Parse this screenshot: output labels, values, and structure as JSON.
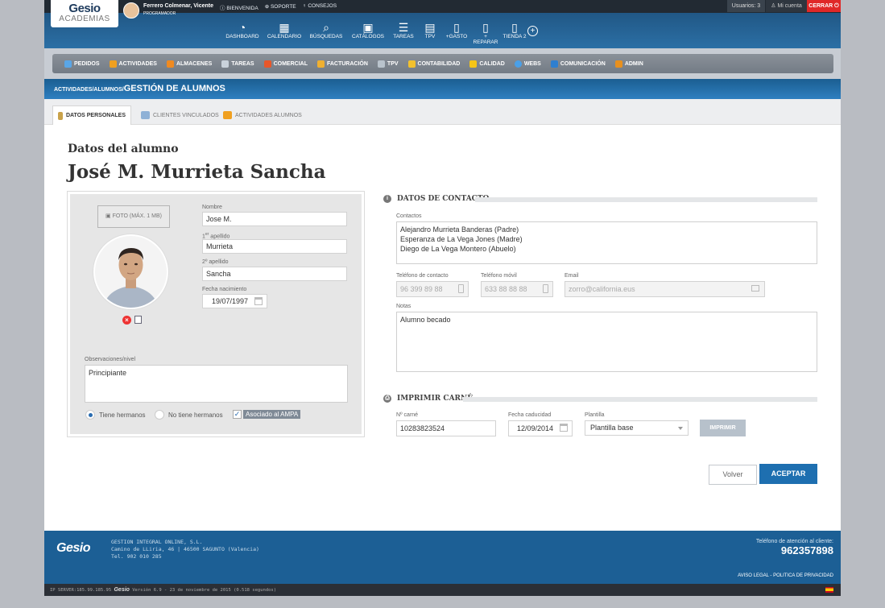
{
  "header": {
    "logo_main": "Gesio",
    "logo_sub": "ACADEMIAS",
    "user_name": "Ferrero Colmenar, Vicente",
    "user_role": "PROGRAMADOR",
    "links": [
      "BIENVENIDA",
      "SOPORTE",
      "CONSEJOS"
    ],
    "users_count": "Usuarios: 3",
    "mi_cuenta": "Mi cuenta",
    "cerrar": "CERRAR"
  },
  "mainnav": [
    {
      "label": "DASHBOARD",
      "icon": "gauge-icon",
      "glyph": "◔"
    },
    {
      "label": "CALENDARIO",
      "icon": "calendar-icon",
      "glyph": "▦"
    },
    {
      "label": "BÚSQUEDAS",
      "icon": "search-icon",
      "glyph": "⌕"
    },
    {
      "label": "CATÁLOGOS",
      "icon": "catalog-icon",
      "glyph": "▣"
    },
    {
      "label": "TAREAS",
      "icon": "list-icon",
      "glyph": "☰"
    },
    {
      "label": "TPV",
      "icon": "cash-register-icon",
      "glyph": "▤"
    },
    {
      "label": "+GASTO",
      "icon": "document-icon",
      "glyph": "▯"
    },
    {
      "label": "+ REPARAR",
      "icon": "document-icon",
      "glyph": "▯"
    },
    {
      "label": "TIENDA 2",
      "icon": "document-icon",
      "glyph": "▯"
    }
  ],
  "modules": [
    {
      "label": "PEDIDOS",
      "color": "#5aa6e6"
    },
    {
      "label": "ACTIVIDADES",
      "color": "#f0a020"
    },
    {
      "label": "ALMACENES",
      "color": "#f08a20"
    },
    {
      "label": "TAREAS",
      "color": "#c9d2db"
    },
    {
      "label": "COMERCIAL",
      "color": "#e8572a"
    },
    {
      "label": "FACTURACIÓN",
      "color": "#f0b030"
    },
    {
      "label": "TPV",
      "color": "#b9c3cc"
    },
    {
      "label": "CONTABILIDAD",
      "color": "#f2c12e"
    },
    {
      "label": "CALIDAD",
      "color": "#f5c518"
    },
    {
      "label": "WEBS",
      "color": "#4aa0e8"
    },
    {
      "label": "COMUNICACIÓN",
      "color": "#2f7fd0"
    },
    {
      "label": "ADMIN",
      "color": "#e8901e"
    }
  ],
  "breadcrumb": {
    "part1": "ACTIVIDADES",
    "sep": "/",
    "part2": "ALUMNOS",
    "current": "GESTIÓN DE ALUMNOS"
  },
  "tabs": [
    {
      "label": "DATOS PERSONALES",
      "active": true
    },
    {
      "label": "CLIENTES VINCULADOS",
      "active": false
    },
    {
      "label": "ACTIVIDADES ALUMNOS",
      "active": false
    }
  ],
  "page": {
    "section_title": "Datos del alumno",
    "person_name": "José M. Murrieta Sancha"
  },
  "left": {
    "foto_button": "FOTO (MÁX. 1 MB)",
    "nombre_label": "Nombre",
    "nombre": "Jose M.",
    "apellido1_prefix": "1",
    "apellido1_sup": "er",
    "apellido1_label": " apellido",
    "apellido1": "Murrieta",
    "apellido2_label": "2º apellido",
    "apellido2": "Sancha",
    "nacimiento_label": "Fecha nacimiento",
    "nacimiento": "19/07/1997",
    "observaciones_label": "Observaciones/nivel",
    "observaciones": "Principiante",
    "radio_hermanos": "Tiene hermanos",
    "radio_no_hermanos": "No tiene hermanos",
    "checkbox_ampa": "Asociado al AMPA",
    "tiene_hermanos_selected": true,
    "ampa_checked": true
  },
  "contact": {
    "section_title": "DATOS DE CONTACTO",
    "contactos_label": "Contactos",
    "contactos": "Alejandro Murrieta Banderas (Padre)\nEsperanza de La Vega Jones (Madre)\nDiego de La Vega Montero (Abuelo)",
    "telefono_label": "Teléfono de contacto",
    "telefono": "96 399 89 88",
    "movil_label": "Teléfono móvil",
    "movil": "633 88 88 88",
    "email_label": "Email",
    "email": "zorro@california.eus",
    "notas_label": "Notas",
    "notas": "Alumno becado"
  },
  "carne": {
    "section_title": "IMPRIMIR CARNÉ",
    "numero_label": "Nº carné",
    "numero": "10283823524",
    "caducidad_label": "Fecha caducidad",
    "caducidad": "12/09/2014",
    "plantilla_label": "Plantilla",
    "plantilla": "Plantilla base",
    "imprimir": "IMPRIMIR"
  },
  "actions": {
    "volver": "Volver",
    "aceptar": "ACEPTAR"
  },
  "footer": {
    "logo": "Gesio",
    "company": "GESTION INTEGRAL ONLINE, S.L.\nCamino de LLiria, 46 | 46500 SAGUNTO (Valencia)\nTel. 902 010 285",
    "phone_label": "Teléfono de atención al cliente:",
    "phone": "962357898",
    "legal": "AVISO LEGAL - POLITICA DE PRIVACIDAD",
    "server": "IP SERVER:185.99.185.95",
    "bb_logo": "Gesio",
    "version": "Versión 6.9 - 23 de noviembre de 2015 (0.518 segundos)"
  }
}
